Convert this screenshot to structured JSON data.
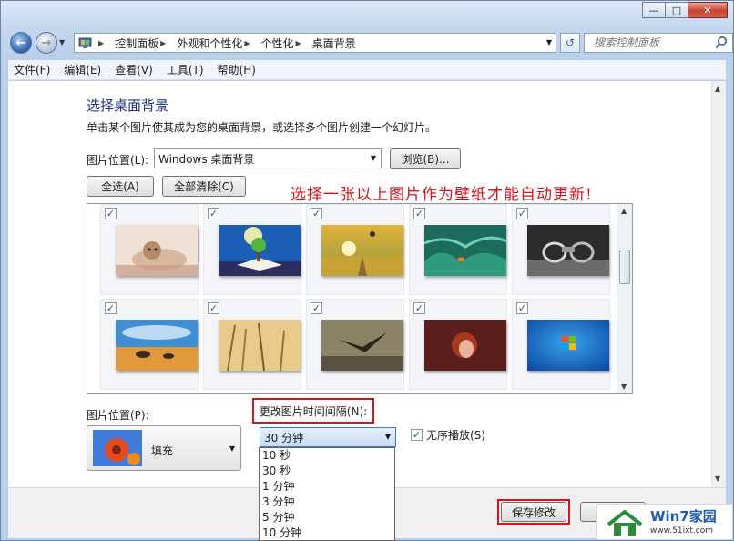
{
  "window": {
    "caption_buttons": [
      "minimize",
      "maximize",
      "close"
    ]
  },
  "nav": {
    "breadcrumbs": [
      "控制面板",
      "外观和个性化",
      "个性化",
      "桌面背景"
    ],
    "search_placeholder": "搜索控制面板"
  },
  "menu": [
    "文件(F)",
    "编辑(E)",
    "查看(V)",
    "工具(T)",
    "帮助(H)"
  ],
  "main": {
    "title": "选择桌面背景",
    "description": "单击某个图片使其成为您的桌面背景，或选择多个图片创建一个幻灯片。",
    "location_label": "图片位置(L):",
    "location_value": "Windows 桌面背景",
    "browse_label": "浏览(B)...",
    "select_all_label": "全选(A)",
    "clear_all_label": "全部清除(C)",
    "annotation": "选择一张以上图片作为壁纸才能自动更新!"
  },
  "grid": {
    "tiles": [
      {
        "name": "kitten",
        "checked": true
      },
      {
        "name": "book-tree",
        "checked": true
      },
      {
        "name": "sunset-field",
        "checked": true
      },
      {
        "name": "anemone-fish",
        "checked": true
      },
      {
        "name": "metal-car",
        "checked": true
      },
      {
        "name": "beach-rocks",
        "checked": true
      },
      {
        "name": "wheat",
        "checked": true
      },
      {
        "name": "bird",
        "checked": true
      },
      {
        "name": "girl",
        "checked": true
      },
      {
        "name": "windows-logo",
        "checked": true
      }
    ]
  },
  "bottom": {
    "position_label": "图片位置(P):",
    "position_value": "填充",
    "interval_label": "更改图片时间间隔(N):",
    "interval_value": "30 分钟",
    "shuffle_label": "无序播放(S)",
    "shuffle_checked": true,
    "interval_options": [
      "10 秒",
      "30 秒",
      "1 分钟",
      "3 分钟",
      "5 分钟",
      "10 分钟"
    ],
    "save_label": "保存修改"
  },
  "watermark": {
    "title": "Win7家园",
    "url": "www.51ixt.com"
  },
  "colors": {
    "annotation_red": "#e0101a",
    "title_blue": "#1e3287"
  }
}
